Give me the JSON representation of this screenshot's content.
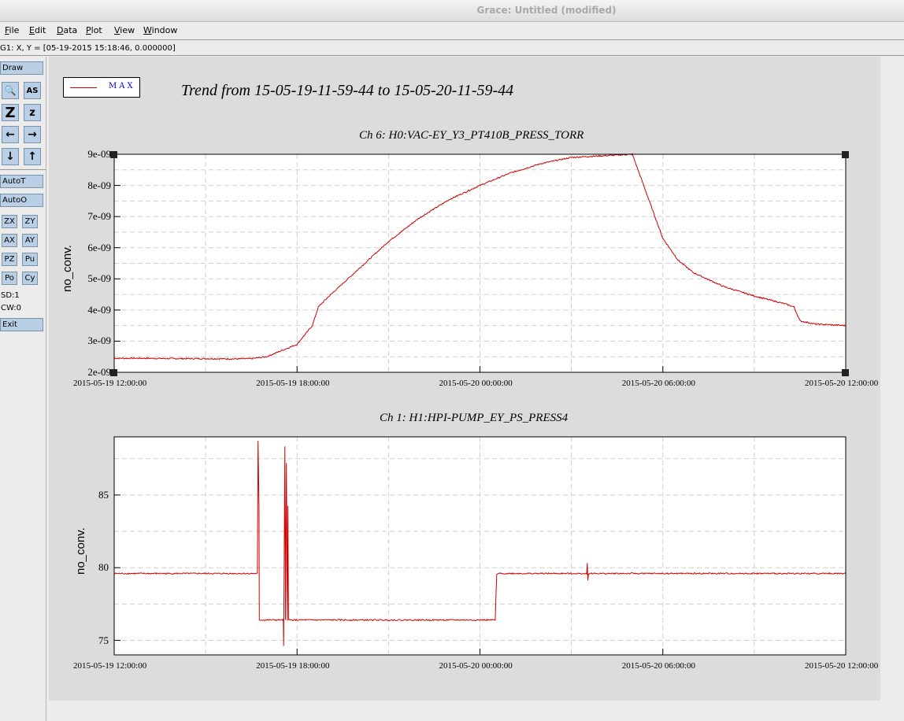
{
  "window": {
    "title": "Grace: Untitled (modified)"
  },
  "menu": [
    {
      "label": "File",
      "key": "F",
      "rest": "ile"
    },
    {
      "label": "Edit",
      "key": "E",
      "rest": "dit"
    },
    {
      "label": "Data",
      "key": "D",
      "rest": "ata"
    },
    {
      "label": "Plot",
      "key": "P",
      "rest": "lot"
    },
    {
      "label": "View",
      "key": "V",
      "rest": "iew"
    },
    {
      "label": "Window",
      "key": "W",
      "rest": "indow"
    }
  ],
  "locator": {
    "text": "G1: X, Y = [05-19-2015 15:18:46, 0.000000]"
  },
  "sidebar": {
    "draw": "Draw",
    "icons": [
      "zoom-icon",
      "autoscale-text-icon",
      "zoom-in-icon",
      "zoom-out-icon",
      "scroll-left-icon",
      "scroll-right-icon",
      "scroll-down-icon",
      "scroll-up-icon"
    ],
    "icon_glyphs": [
      "🔍",
      "AS",
      "Z",
      "z",
      "←",
      "→",
      "↓",
      "↑"
    ],
    "autot": "AutoT",
    "autoo": "AutoO",
    "small_buttons": [
      "ZX",
      "ZY",
      "AX",
      "AY",
      "PZ",
      "Pu",
      "Po",
      "Cy"
    ],
    "sd": "SD:1",
    "cw": "CW:0",
    "exit": "Exit"
  },
  "legend": {
    "label": "MAX",
    "color": "#cc0000"
  },
  "main_title": "Trend from 15-05-19-11-59-44 to 15-05-20-11-59-44",
  "chart_data": [
    {
      "type": "line",
      "title": "Ch 6: H0:VAC-EY_Y3_PT410B_PRESS_TORR",
      "ylabel": "no_conv.",
      "xlim": [
        "2015-05-19 12:00:00",
        "2015-05-20 12:00:00"
      ],
      "ylim": [
        2e-09,
        9e-09
      ],
      "yticks": [
        "9e-09",
        "8e-09",
        "7e-09",
        "6e-09",
        "5e-09",
        "4e-09",
        "3e-09",
        "2e-09"
      ],
      "xticks": [
        "2015-05-19 12:00:00",
        "2015-05-19 18:00:00",
        "2015-05-20 00:00:00",
        "2015-05-20 06:00:00",
        "2015-05-20 12:00:00"
      ],
      "grid": true,
      "series": [
        {
          "name": "MAX",
          "color": "#cc0000",
          "x_hours": [
            0,
            1,
            2,
            3,
            4,
            4.5,
            5,
            5.5,
            6,
            6.5,
            6.7,
            7,
            8,
            9,
            10,
            11,
            12,
            13,
            14,
            15,
            16,
            17,
            18,
            18.5,
            19,
            20,
            21,
            22,
            22.3,
            22.5,
            23,
            24
          ],
          "y": [
            2.45e-09,
            2.45e-09,
            2.44e-09,
            2.44e-09,
            2.43e-09,
            2.44e-09,
            2.5e-09,
            2.7e-09,
            2.9e-09,
            3.5e-09,
            4.1e-09,
            4.4e-09,
            5.3e-09,
            6.2e-09,
            6.95e-09,
            7.55e-09,
            8e-09,
            8.4e-09,
            8.7e-09,
            8.9e-09,
            8.95e-09,
            9e-09,
            6.3e-09,
            5.6e-09,
            5.2e-09,
            4.75e-09,
            4.45e-09,
            4.2e-09,
            4.1e-09,
            3.65e-09,
            3.55e-09,
            3.5e-09
          ]
        }
      ]
    },
    {
      "type": "line",
      "title": "Ch 1: H1:HPI-PUMP_EY_PS_PRESS4",
      "ylabel": "no_conv.",
      "xlim": [
        "2015-05-19 12:00:00",
        "2015-05-20 12:00:00"
      ],
      "ylim": [
        74,
        89
      ],
      "yticks": [
        "85",
        "80",
        "75"
      ],
      "xticks": [
        "2015-05-19 12:00:00",
        "2015-05-19 18:00:00",
        "2015-05-20 00:00:00",
        "2015-05-20 06:00:00",
        "2015-05-20 12:00:00"
      ],
      "grid": true,
      "series": [
        {
          "name": "MAX",
          "color": "#cc0000",
          "x_hours": [
            0,
            4.7,
            4.72,
            4.75,
            4.76,
            4.78,
            5.3,
            5.55,
            5.56,
            5.6,
            5.62,
            5.65,
            5.68,
            5.7,
            5.72,
            5.75,
            5.8,
            12.5,
            12.55,
            12.6,
            15.5,
            15.52,
            15.54,
            15.56,
            24
          ],
          "y": [
            79.6,
            79.6,
            88.7,
            84.2,
            76.4,
            76.4,
            76.4,
            76.4,
            74.6,
            88.3,
            76.4,
            87.2,
            76.4,
            84.3,
            76.4,
            76.4,
            76.4,
            76.4,
            79.5,
            79.6,
            79.6,
            80.3,
            79.1,
            79.6,
            79.6
          ]
        }
      ]
    }
  ]
}
